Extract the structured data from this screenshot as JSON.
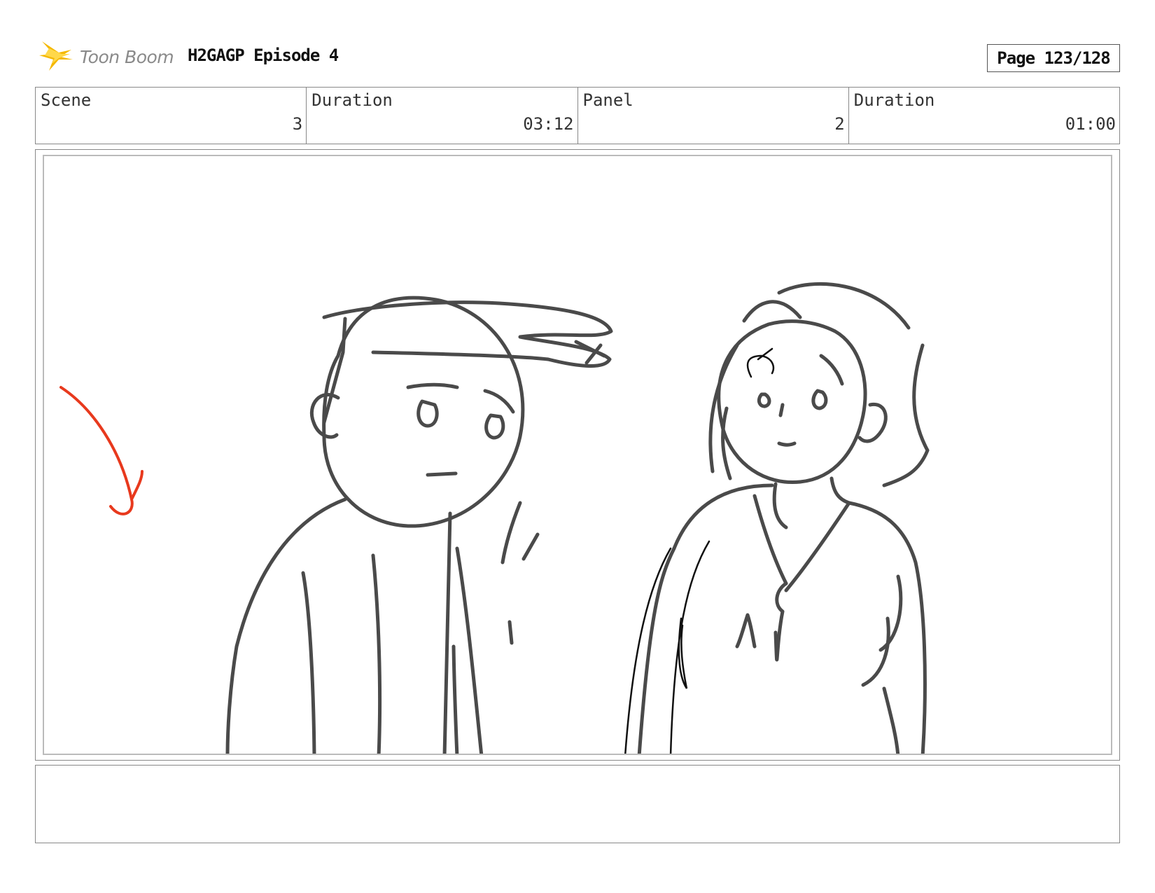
{
  "header": {
    "logo_text": "Toon Boom",
    "episode_title": "H2GAGP Episode 4",
    "page_label": "Page 123/128"
  },
  "info": {
    "scene_label": "Scene",
    "scene_value": "3",
    "scene_duration_label": "Duration",
    "scene_duration_value": "03:12",
    "panel_label": "Panel",
    "panel_value": "2",
    "panel_duration_label": "Duration",
    "panel_duration_value": "01:00"
  },
  "colors": {
    "sketch": "#4a4a4a",
    "arrow": "#e8391d",
    "logo_flame": "#f5b800"
  },
  "notes": {
    "text": ""
  }
}
